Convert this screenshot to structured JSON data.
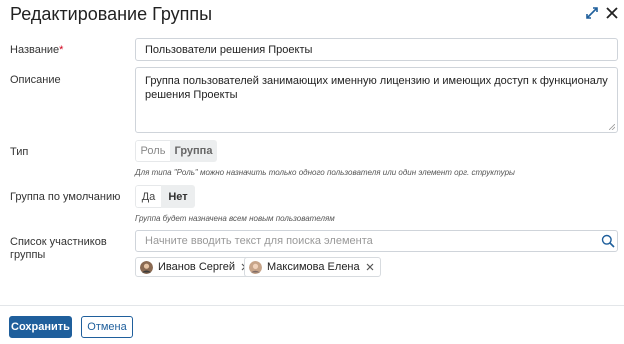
{
  "dialog": {
    "title": "Редактирование Группы",
    "icons": {
      "expand": "expand-arrows-icon",
      "close": "close-icon"
    }
  },
  "fields": {
    "name": {
      "label": "Название",
      "required_mark": "*",
      "value": "Пользователи решения Проекты"
    },
    "description": {
      "label": "Описание",
      "value": "Группа пользователей занимающих именную лицензию и имеющих доступ к функционалу решения Проекты"
    },
    "type": {
      "label": "Тип",
      "options": [
        "Роль",
        "Группа"
      ],
      "selected": "Группа",
      "hint": "Для типа \"Роль\" можно назначить только одного пользователя или один элемент орг. структуры"
    },
    "default_group": {
      "label": "Группа по умолчанию",
      "options": [
        "Да",
        "Нет"
      ],
      "selected": "Нет",
      "hint": "Группа будет назначена всем новым пользователям"
    },
    "members": {
      "label_line1": "Список участников",
      "label_line2": "группы",
      "search_placeholder": "Начните вводить текст для поиска элемента",
      "tags": [
        {
          "name": "Иванов Сергей"
        },
        {
          "name": "Максимова Елена"
        }
      ]
    }
  },
  "footer": {
    "save_label": "Сохранить",
    "cancel_label": "Отмена"
  },
  "colors": {
    "primary": "#1f5f9c",
    "required": "#d0021b",
    "border": "#cfd4da",
    "selected_segment": "#eceeef"
  }
}
